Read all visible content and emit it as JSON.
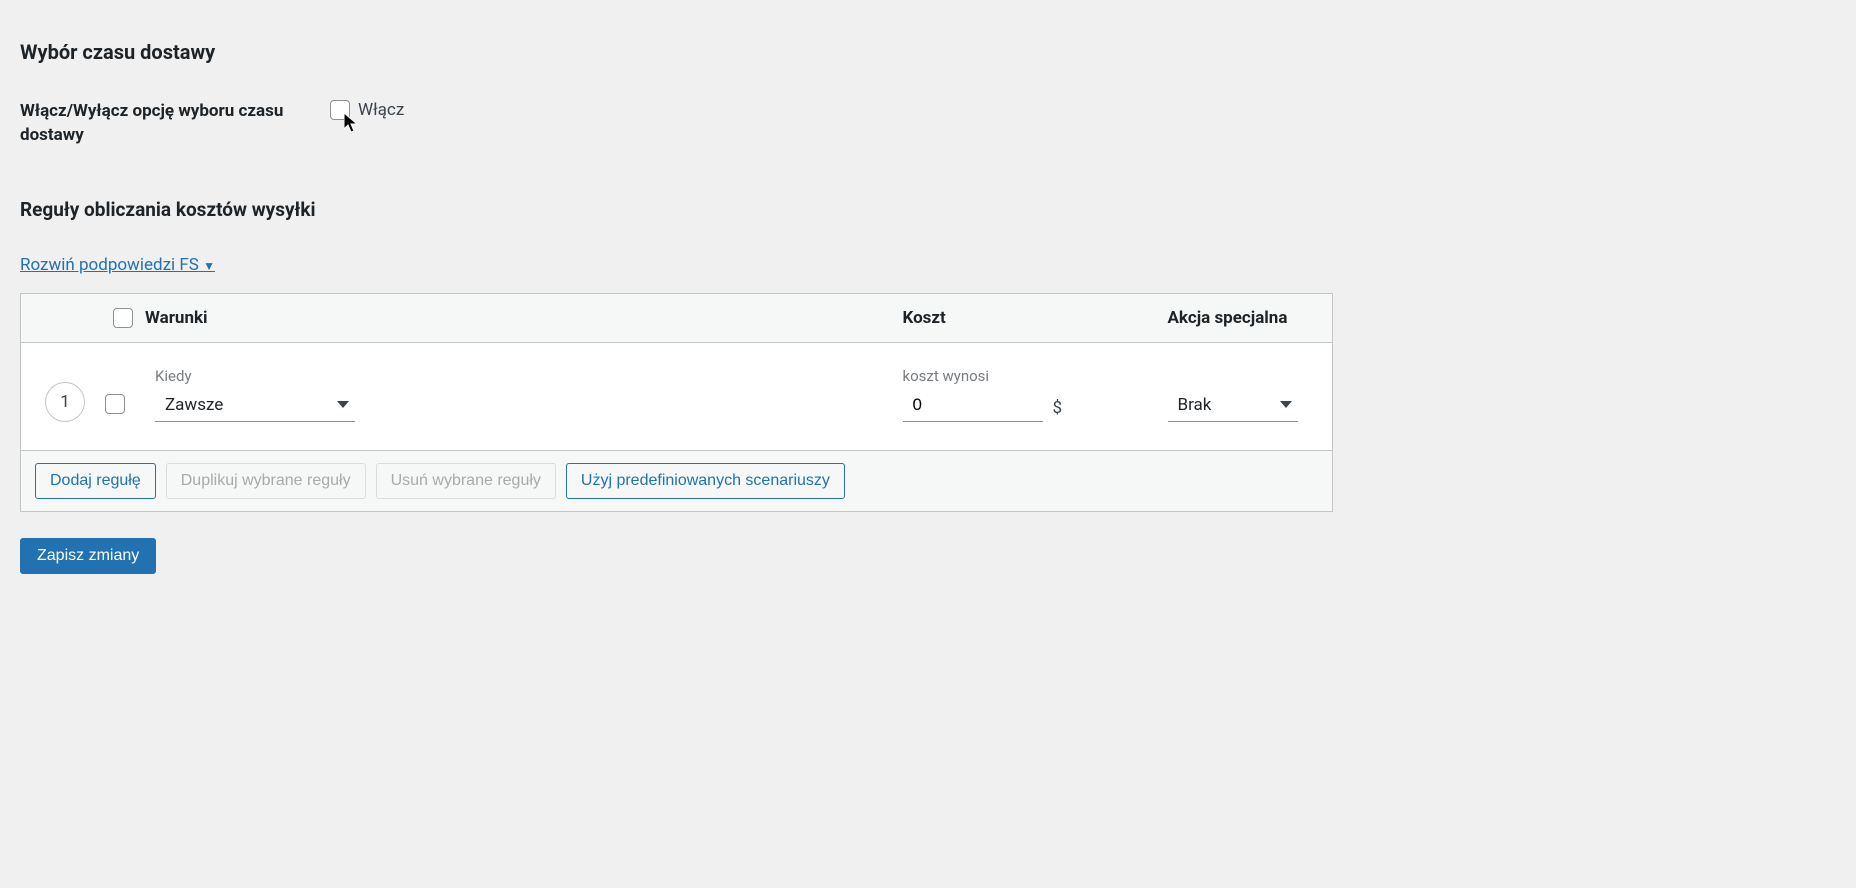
{
  "delivery_section": {
    "title": "Wybór czasu dostawy",
    "toggle_label": "Włącz/Wyłącz opcję wyboru czasu dostawy",
    "toggle_text": "Włącz"
  },
  "rules_section": {
    "title": "Reguły obliczania kosztów wysyłki",
    "expand_link_text": "Rozwiń podpowiedzi FS",
    "expand_triangle": "▼"
  },
  "table": {
    "headers": {
      "conditions": "Warunki",
      "cost": "Koszt",
      "special_action": "Akcja specjalna"
    },
    "row": {
      "number": "1",
      "when_label": "Kiedy",
      "when_value": "Zawsze",
      "cost_label": "koszt wynosi",
      "cost_value": "0",
      "currency": "$",
      "action_value": "Brak"
    },
    "buttons": {
      "add_rule": "Dodaj regułę",
      "duplicate": "Duplikuj wybrane reguły",
      "delete": "Usuń wybrane reguły",
      "predefined": "Użyj predefiniowanych scenariuszy"
    }
  },
  "save_button": "Zapisz zmiany"
}
